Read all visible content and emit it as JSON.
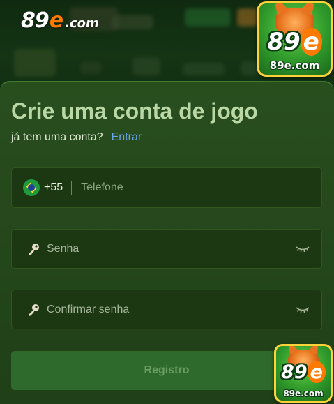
{
  "brand": {
    "number": "89",
    "e_letter": "e",
    "domain": ".com"
  },
  "badge": {
    "number": "89",
    "e_letter": "e",
    "domain": "89e.com"
  },
  "form": {
    "title": "Crie uma conta de jogo",
    "has_account_text": "já tem uma conta?",
    "login_link": "Entrar",
    "phone": {
      "country_code": "+55",
      "placeholder": "Telefone",
      "flag_icon": "brazil-flag-icon"
    },
    "password": {
      "placeholder": "Senha",
      "icon": "key-icon",
      "visibility_icon": "eye-closed-icon"
    },
    "confirm_password": {
      "placeholder": "Confirmar senha",
      "icon": "key-icon",
      "visibility_icon": "eye-closed-icon"
    },
    "register_button": "Registro"
  },
  "colors": {
    "title": "#b9d8a6",
    "link": "#6ba3e8",
    "accent_orange": "#ff7a00",
    "register_button": "#2d6a2c",
    "register_text": "#6a9b62"
  }
}
